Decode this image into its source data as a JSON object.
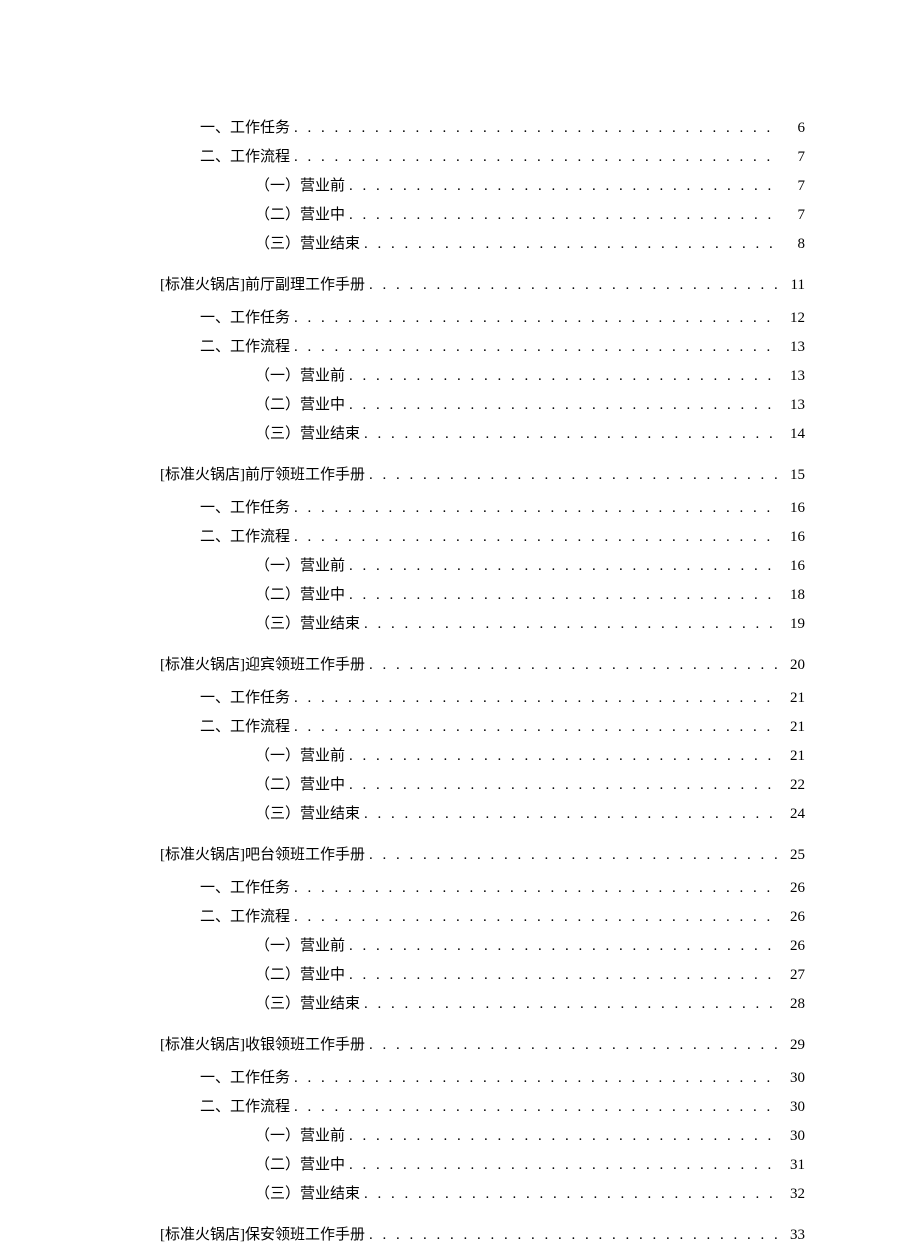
{
  "toc": [
    {
      "level": 2,
      "label": "一、工作任务",
      "page": "6"
    },
    {
      "level": 2,
      "label": "二、工作流程",
      "page": "7"
    },
    {
      "level": 3,
      "label": "（一）营业前",
      "page": "7"
    },
    {
      "level": 3,
      "label": "（二）营业中",
      "page": "7"
    },
    {
      "level": 3,
      "label": "（三）营业结束",
      "page": "8"
    },
    {
      "level": 1,
      "label": "[标准火锅店]前厅副理工作手册",
      "page": "11"
    },
    {
      "level": 2,
      "label": "一、工作任务",
      "page": "12"
    },
    {
      "level": 2,
      "label": "二、工作流程",
      "page": "13"
    },
    {
      "level": 3,
      "label": "（一）营业前",
      "page": "13"
    },
    {
      "level": 3,
      "label": "（二）营业中",
      "page": "13"
    },
    {
      "level": 3,
      "label": "（三）营业结束",
      "page": "14"
    },
    {
      "level": 1,
      "label": "[标准火锅店]前厅领班工作手册",
      "page": "15"
    },
    {
      "level": 2,
      "label": "一、工作任务",
      "page": "16"
    },
    {
      "level": 2,
      "label": "二、工作流程",
      "page": "16"
    },
    {
      "level": 3,
      "label": "（一）营业前",
      "page": "16"
    },
    {
      "level": 3,
      "label": "（二）营业中",
      "page": "18"
    },
    {
      "level": 3,
      "label": "（三）营业结束",
      "page": "19"
    },
    {
      "level": 1,
      "label": "[标准火锅店]迎宾领班工作手册",
      "page": "20"
    },
    {
      "level": 2,
      "label": "一、工作任务",
      "page": "21"
    },
    {
      "level": 2,
      "label": "二、工作流程",
      "page": "21"
    },
    {
      "level": 3,
      "label": "（一）营业前",
      "page": "21"
    },
    {
      "level": 3,
      "label": "（二）营业中",
      "page": "22"
    },
    {
      "level": 3,
      "label": "（三）营业结束",
      "page": "24"
    },
    {
      "level": 1,
      "label": "[标准火锅店]吧台领班工作手册",
      "page": "25"
    },
    {
      "level": 2,
      "label": "一、工作任务",
      "page": "26"
    },
    {
      "level": 2,
      "label": "二、工作流程",
      "page": "26"
    },
    {
      "level": 3,
      "label": "（一）营业前",
      "page": "26"
    },
    {
      "level": 3,
      "label": "（二）营业中",
      "page": "27"
    },
    {
      "level": 3,
      "label": "（三）营业结束",
      "page": "28"
    },
    {
      "level": 1,
      "label": "[标准火锅店]收银领班工作手册",
      "page": "29"
    },
    {
      "level": 2,
      "label": "一、工作任务",
      "page": "30"
    },
    {
      "level": 2,
      "label": "二、工作流程",
      "page": "30"
    },
    {
      "level": 3,
      "label": "（一）营业前",
      "page": "30"
    },
    {
      "level": 3,
      "label": "（二）营业中",
      "page": "31"
    },
    {
      "level": 3,
      "label": "（三）营业结束",
      "page": "32"
    },
    {
      "level": 1,
      "label": "[标准火锅店]保安领班工作手册",
      "page": "33"
    }
  ]
}
